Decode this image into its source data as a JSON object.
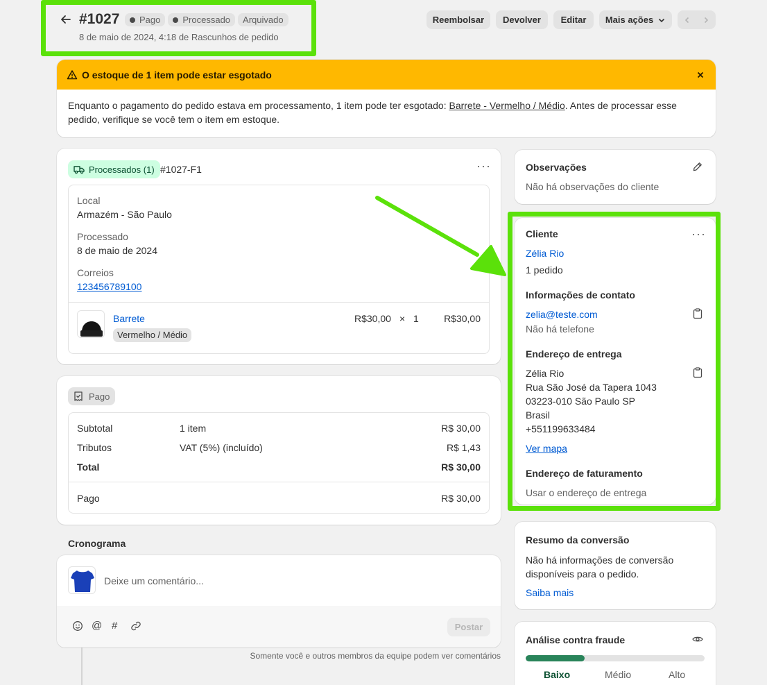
{
  "header": {
    "order_number": "#1027",
    "badges": [
      "Pago",
      "Processado",
      "Arquivado"
    ],
    "subtitle": "8 de maio de 2024, 4:18 de Rascunhos de pedido",
    "actions": [
      "Reembolsar",
      "Devolver",
      "Editar",
      "Mais ações"
    ],
    "prev_icon": "chevron-left-icon",
    "next_icon": "chevron-right-icon"
  },
  "alert": {
    "title": "O estoque de 1 item pode estar esgotado",
    "body_prefix": "Enquanto o pagamento do pedido estava em processamento, 1 item pode ter esgotado: ",
    "body_link": "Barrete - Vermelho / Médio",
    "body_suffix": ". Antes de processar esse pedido, verifique se você tem o item em estoque.",
    "color": "#ffb800"
  },
  "fulfillment": {
    "status": "Processados (1)",
    "id": "#1027-F1",
    "location_label": "Local",
    "location_value": "Armazém - São Paulo",
    "processed_label": "Processado",
    "processed_value": "8 de maio de 2024",
    "carrier_label": "Correios",
    "tracking": "123456789100",
    "item": {
      "name": "Barrete",
      "variant": "Vermelho / Médio",
      "price": "R$30,00",
      "times": "×",
      "qty": "1",
      "total": "R$30,00"
    }
  },
  "payment": {
    "status": "Pago",
    "subtotal_label": "Subtotal",
    "subtotal_desc": "1 item",
    "subtotal_value": "R$ 30,00",
    "taxes_label": "Tributos",
    "taxes_desc": "VAT (5%) (incluído)",
    "taxes_value": "R$ 1,43",
    "total_label": "Total",
    "total_value": "R$ 30,00",
    "paid_label": "Pago",
    "paid_value": "R$ 30,00"
  },
  "timeline": {
    "title": "Cronograma",
    "placeholder": "Deixe um comentário...",
    "post_label": "Postar",
    "footnote": "Somente você e outros membros da equipe podem ver comentários"
  },
  "notes": {
    "title": "Observações",
    "text": "Não há observações do cliente"
  },
  "customer": {
    "title": "Cliente",
    "name": "Zélia Rio",
    "orders": "1 pedido",
    "contact_title": "Informações de contato",
    "email": "zelia@teste.com",
    "phone": "Não há telefone",
    "shipping_title": "Endereço de entrega",
    "address_lines": [
      "Zélia Rio",
      "Rua São José da Tapera 1043",
      "03223-010 São Paulo SP",
      "Brasil",
      "+551199633484"
    ],
    "map_link": "Ver mapa",
    "billing_title": "Endereço de faturamento",
    "billing_text": "Usar o endereço de entrega"
  },
  "conversion": {
    "title": "Resumo da conversão",
    "text": "Não há informações de conversão disponíveis para o pedido.",
    "link": "Saiba mais"
  },
  "fraud": {
    "title": "Análise contra fraude",
    "level": 0.33,
    "levels": [
      "Baixo",
      "Médio",
      "Alto"
    ],
    "color": "#29845a"
  },
  "highlight_color": "#5be10a"
}
